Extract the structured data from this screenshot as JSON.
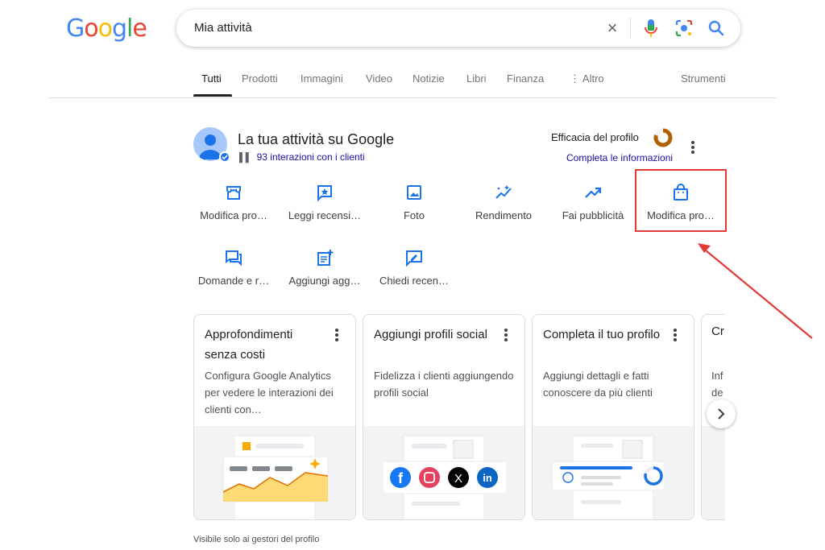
{
  "search": {
    "query": "Mia attività",
    "icons": [
      "close-icon",
      "mic-icon",
      "lens-icon",
      "search-icon"
    ]
  },
  "tabs": [
    {
      "label": "Tutti",
      "active": true
    },
    {
      "label": "Prodotti"
    },
    {
      "label": "Immagini"
    },
    {
      "label": "Video"
    },
    {
      "label": "Notizie"
    },
    {
      "label": "Libri"
    },
    {
      "label": "Finanza"
    },
    {
      "label": "⋮ Altro"
    }
  ],
  "tools_label": "Strumenti",
  "business": {
    "title": "La tua attività su Google",
    "interactions": "93 interazioni con i clienti",
    "efficacy_label": "Efficacia del profilo",
    "complete_link": "Completa le informazioni"
  },
  "actions": [
    {
      "label": "Modifica pro…",
      "icon": "store-icon"
    },
    {
      "label": "Leggi recensi…",
      "icon": "review-star-icon"
    },
    {
      "label": "Foto",
      "icon": "photo-icon"
    },
    {
      "label": "Rendimento",
      "icon": "sparkle-trend-icon"
    },
    {
      "label": "Fai pubblicità",
      "icon": "trending-up-icon"
    },
    {
      "label": "Modifica pro…",
      "icon": "shopping-bag-icon"
    },
    {
      "label": "Domande e r…",
      "icon": "forum-icon"
    },
    {
      "label": "Aggiungi agg…",
      "icon": "post-add-icon"
    },
    {
      "label": "Chiedi recen…",
      "icon": "rate-review-icon"
    }
  ],
  "cards": [
    {
      "title": "Approfondimenti senza costi",
      "desc": "Configura Google Analytics per vedere le interazioni dei clienti con…"
    },
    {
      "title": "Aggiungi profili social",
      "desc": "Fidelizza i clienti aggiungendo profili social"
    },
    {
      "title": "Completa il tuo profilo",
      "desc": "Aggiungi dettagli e fatti conoscere da più clienti"
    },
    {
      "title": "Cr",
      "desc": "Inf de"
    }
  ],
  "footer_note": "Visibile solo ai gestori del profilo",
  "colors": {
    "accent": "#1a73e8",
    "highlight": "#e53935",
    "efficacy_ring": "#b06000"
  }
}
